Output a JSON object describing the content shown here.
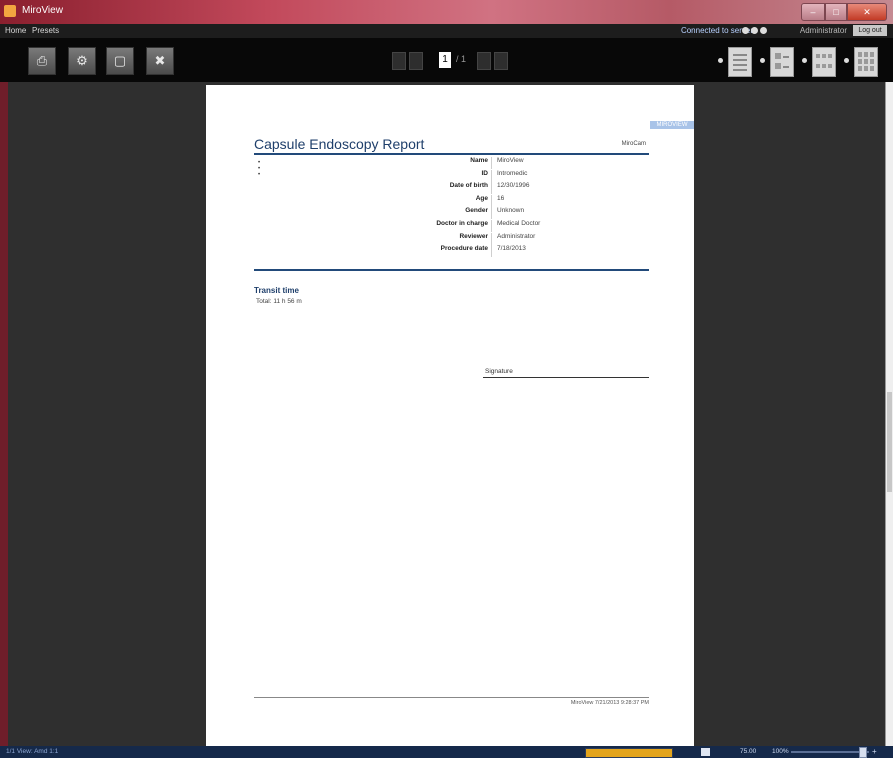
{
  "window": {
    "title": "MiroView",
    "controls": {
      "minimize": "–",
      "maximize": "□",
      "close": "✕"
    }
  },
  "menu": {
    "items": [
      "Home",
      "Presets"
    ],
    "connection_label": "Connected to server",
    "user": "Administrator",
    "logout_label": "Log out"
  },
  "toolbar": {
    "buttons": [
      {
        "name": "print-button",
        "icon": "printer-icon",
        "glyph": "⎙"
      },
      {
        "name": "settings-button",
        "icon": "gear-icon",
        "glyph": "⚙"
      },
      {
        "name": "export-button",
        "icon": "document-icon",
        "glyph": "▢"
      },
      {
        "name": "close-report-button",
        "icon": "close-icon",
        "glyph": "✖"
      }
    ],
    "pager": {
      "current": "1",
      "total": "/ 1"
    },
    "view_modes": [
      "single-page",
      "two-columns",
      "three-columns",
      "grid"
    ]
  },
  "report": {
    "title": "Capsule Endoscopy Report",
    "brand": "MiroCam",
    "logo_stamp": "MIROVIEW",
    "bullets": [
      "•",
      "•",
      "•"
    ],
    "patient_info": [
      {
        "label": "Name",
        "value": "MiroView"
      },
      {
        "label": "ID",
        "value": "Intromedic"
      },
      {
        "label": "Date of birth",
        "value": "12/30/1996"
      },
      {
        "label": "Age",
        "value": "16"
      },
      {
        "label": "Gender",
        "value": "Unknown"
      },
      {
        "label": "Doctor in charge",
        "value": "Medical Doctor"
      },
      {
        "label": "Reviewer",
        "value": "Administrator"
      },
      {
        "label": "Procedure date",
        "value": "7/18/2013"
      }
    ],
    "transit": {
      "section_title": "Transit time",
      "total": "Total: 11 h 56 m"
    },
    "signature_label": "Signature",
    "footer": "MiroView 7/21/2013 9:28:37 PM"
  },
  "status": {
    "left": "1/1 View: Amd 1:1",
    "progress": 1.0,
    "zoom": "75.00",
    "zoom2": "100%",
    "zoom_plus": "+"
  },
  "colors": {
    "title_blue": "#1f3f6b",
    "rule_blue": "#224a7a",
    "progress": "#e3a41c"
  }
}
